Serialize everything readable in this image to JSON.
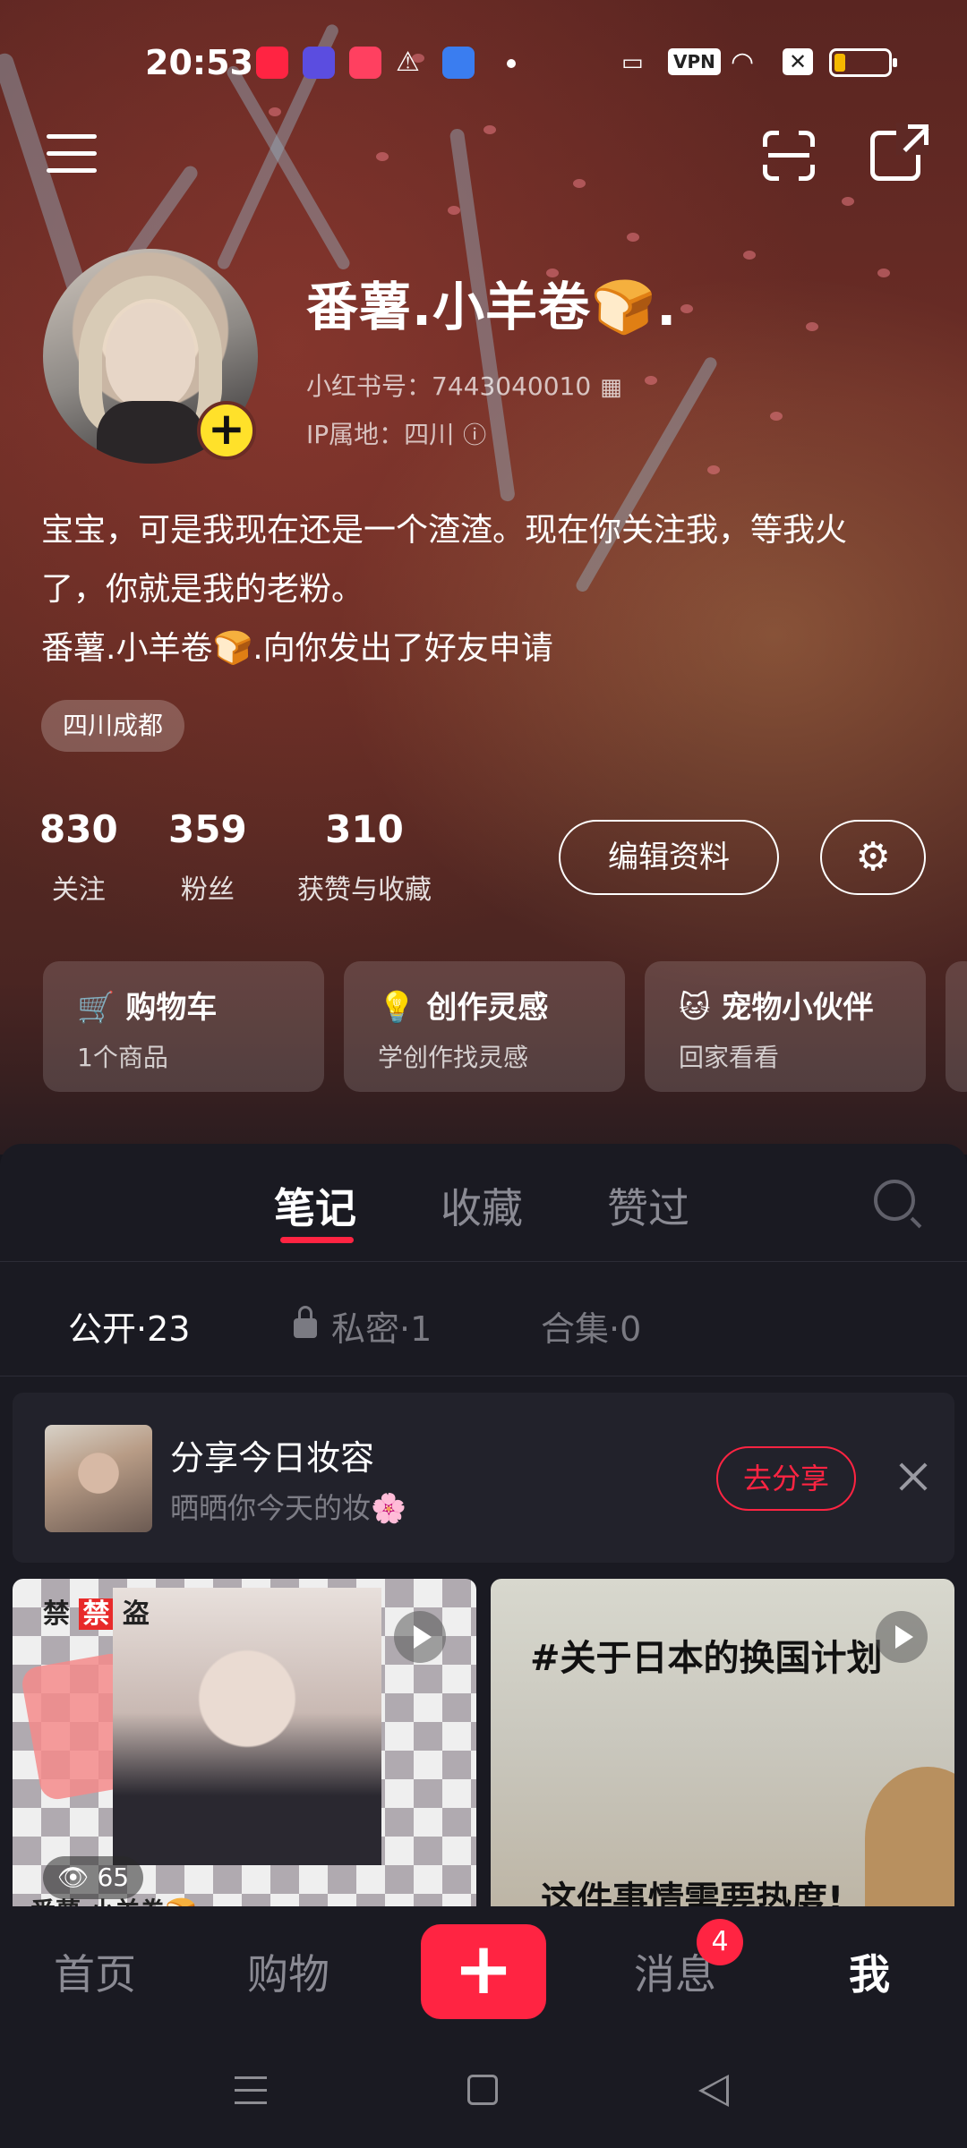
{
  "status_bar": {
    "time": "20:53",
    "vpn_label": "VPN",
    "battery_level_pct": 20,
    "icons": [
      "xiaohongshu-app-icon",
      "cloud-app-icon",
      "recorder-app-icon",
      "warning-icon",
      "bluetooth-app-icon",
      "dot-icon",
      "nfc-icon",
      "vpn-icon",
      "wifi-icon",
      "sim-off-icon",
      "battery-icon"
    ]
  },
  "top_nav": {
    "icons": [
      "menu-icon",
      "scan-icon",
      "share-icon"
    ]
  },
  "profile": {
    "nickname": "番薯.小羊卷🍞.",
    "id_line": "小红书号：7443040010",
    "ip_line": "IP属地：四川",
    "bio_lines": [
      "宝宝，可是我现在还是一个渣渣。现在你关注我，等我火",
      "了，你就是我的老粉。",
      "番薯.小羊卷🍞.向你发出了好友申请"
    ],
    "location_tag": "四川成都",
    "stats": [
      {
        "num": "830",
        "label": "关注"
      },
      {
        "num": "359",
        "label": "粉丝"
      },
      {
        "num": "310",
        "label": "获赞与收藏"
      }
    ],
    "edit_label": "编辑资料",
    "colors": {
      "avatar_add": "#ffe12a"
    }
  },
  "cards": [
    {
      "title": "购物车",
      "sub": "1个商品",
      "icon": "cart-icon"
    },
    {
      "title": "创作灵感",
      "sub": "学创作找灵感",
      "icon": "bulb-icon"
    },
    {
      "title": "宠物小伙伴",
      "sub": "回家看看",
      "icon": "pet-icon"
    }
  ],
  "tabs": [
    "笔记",
    "收藏",
    "赞过"
  ],
  "subtabs": [
    "公开·23",
    "私密·1",
    "合集·0"
  ],
  "banner": {
    "title": "分享今日妆容",
    "sub": "晒晒你今天的妆🌸",
    "button": "去分享"
  },
  "posts": [
    {
      "tag_left": "禁",
      "tag_mid": "禁",
      "tag_right": "盗",
      "views": "65",
      "caption": "番薯.小羊卷🍞"
    },
    {
      "line1": "#关于日本的换国计划",
      "line2": "这件事情需要热度!"
    }
  ],
  "bottom_nav": {
    "items": [
      "首页",
      "购物",
      "消息",
      "我"
    ],
    "plus": "+",
    "badge": "4",
    "accent": "#ff2442"
  }
}
